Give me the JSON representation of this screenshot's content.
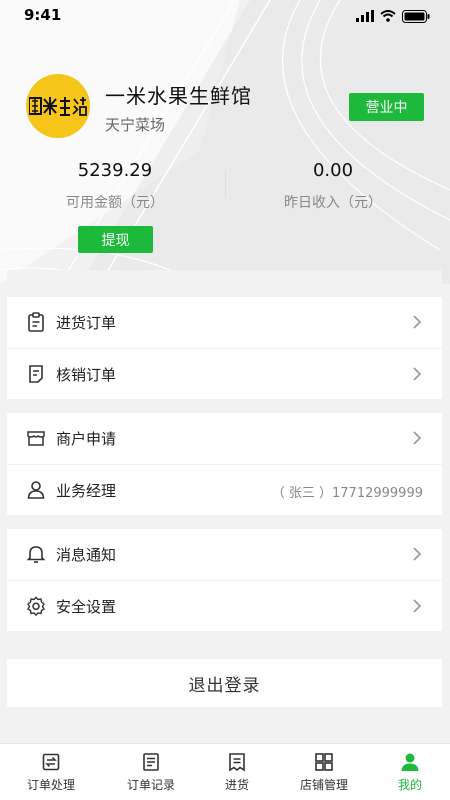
{
  "status_bar": {
    "time": "9:41"
  },
  "store": {
    "logo_text": "畝米生活",
    "name": "一米水果生鲜馆",
    "location": "天宁菜场",
    "status_label": "营业中"
  },
  "stats": {
    "available_amount": "5239.29",
    "available_label": "可用金额（元）",
    "yesterday_income": "0.00",
    "yesterday_label": "昨日收入（元）",
    "withdraw_label": "提现"
  },
  "menu": {
    "group1": [
      {
        "label": "进货订单",
        "icon": "clipboard-icon"
      },
      {
        "label": "核销订单",
        "icon": "document-icon"
      }
    ],
    "group2": [
      {
        "label": "商户申请",
        "icon": "store-icon"
      },
      {
        "label": "业务经理",
        "icon": "person-icon",
        "extra": "（ 张三 ）17712999999"
      }
    ],
    "group3": [
      {
        "label": "消息通知",
        "icon": "bell-icon"
      },
      {
        "label": "安全设置",
        "icon": "gear-icon"
      }
    ]
  },
  "logout_label": "退出登录",
  "tabs": [
    {
      "label": "订单处理",
      "icon": "order-process-icon",
      "active": false
    },
    {
      "label": "订单记录",
      "icon": "order-record-icon",
      "active": false
    },
    {
      "label": "进货",
      "icon": "purchase-icon",
      "active": false
    },
    {
      "label": "店铺管理",
      "icon": "grid-icon",
      "active": false
    },
    {
      "label": "我的",
      "icon": "user-icon",
      "active": true
    }
  ],
  "colors": {
    "accent": "#1db93a",
    "logo_bg": "#f5c519"
  }
}
